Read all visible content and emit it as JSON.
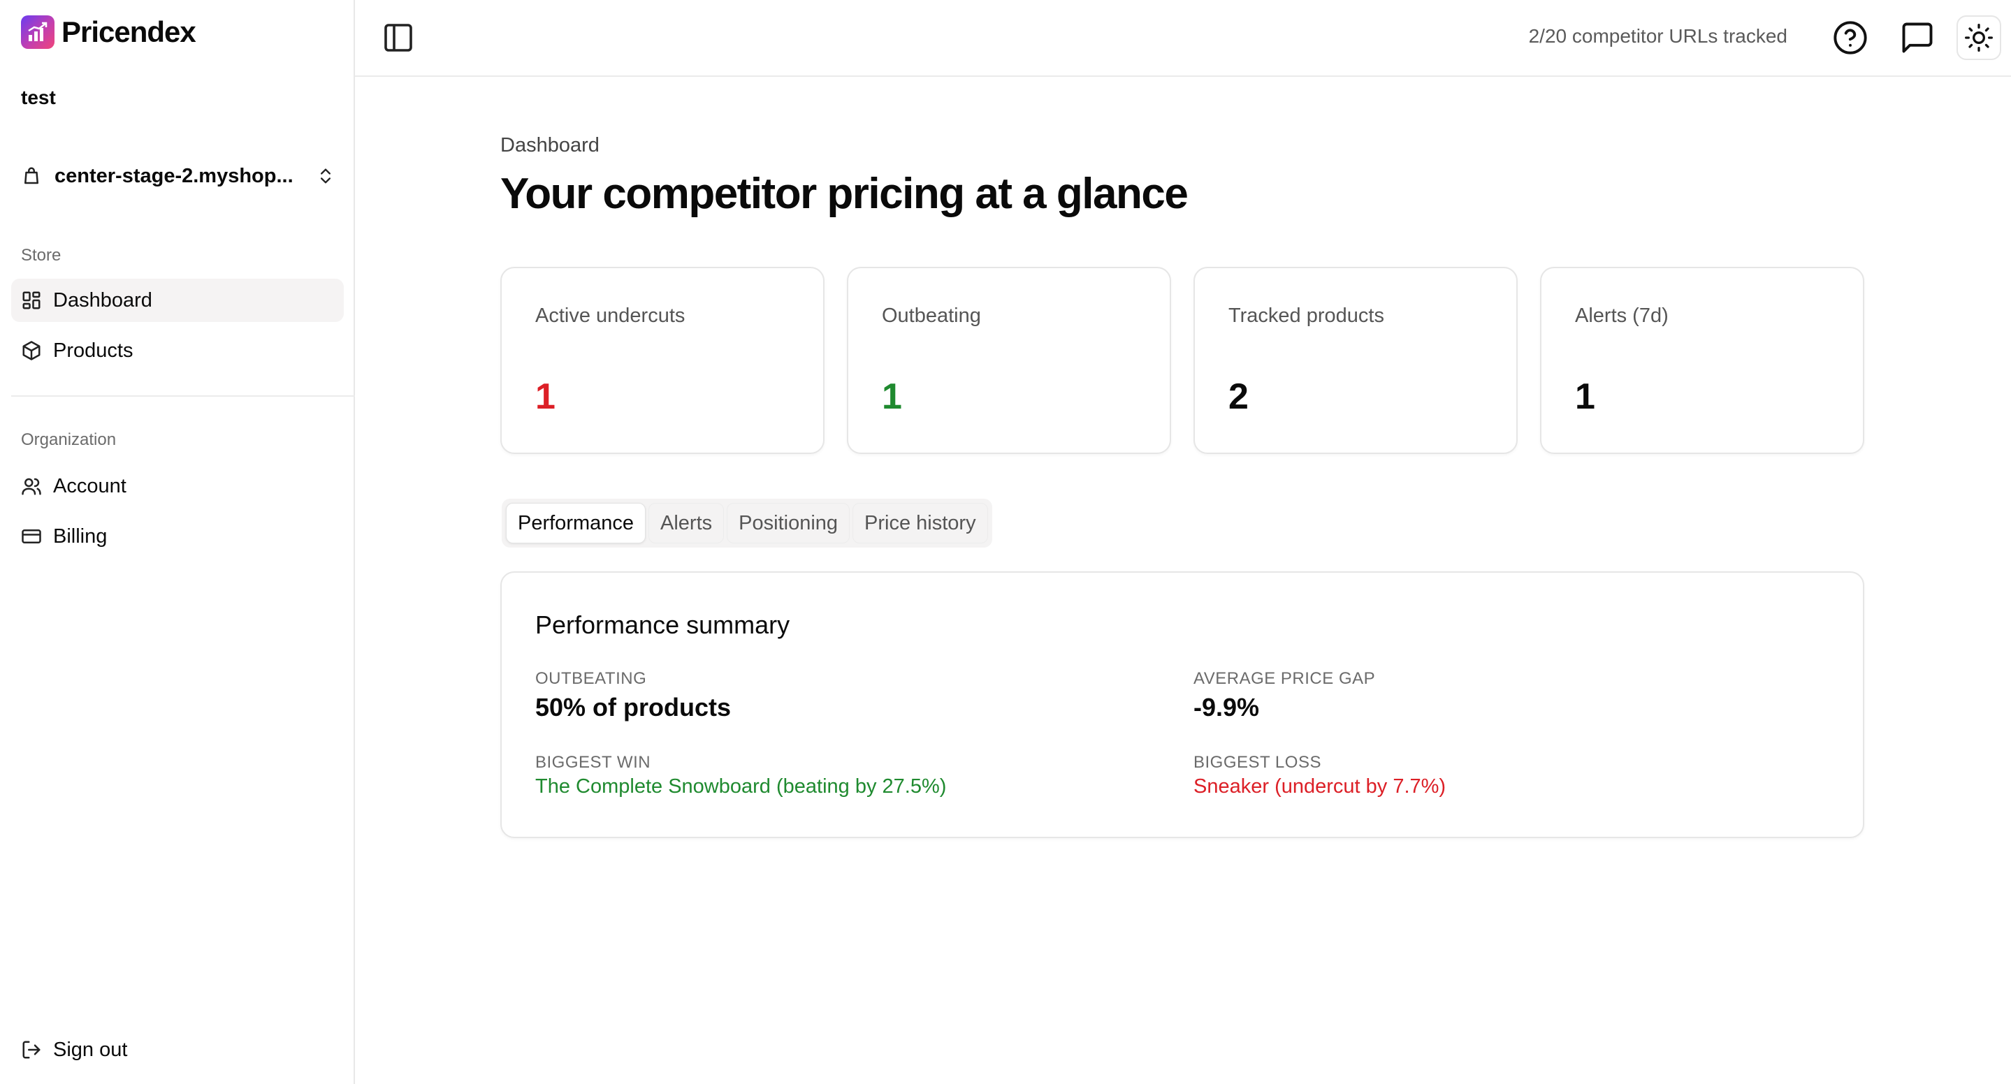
{
  "brand": {
    "name": "Pricendex"
  },
  "sidebar": {
    "org_name": "test",
    "store_selector": "center-stage-2.myshop...",
    "store_section": "Store",
    "store_items": [
      {
        "label": "Dashboard",
        "icon": "dashboard-icon",
        "active": true
      },
      {
        "label": "Products",
        "icon": "box-icon",
        "active": false
      }
    ],
    "org_section": "Organization",
    "org_items": [
      {
        "label": "Account",
        "icon": "users-icon"
      },
      {
        "label": "Billing",
        "icon": "credit-card-icon"
      }
    ],
    "sign_out": "Sign out"
  },
  "topbar": {
    "url_count": "2/20 competitor URLs tracked",
    "icons": [
      "sidebar-toggle-icon",
      "help-icon",
      "message-icon",
      "sun-icon"
    ]
  },
  "page": {
    "breadcrumb": "Dashboard",
    "title": "Your competitor pricing at a glance"
  },
  "stats": [
    {
      "label": "Active undercuts",
      "value": "1",
      "color": "#dc1f26"
    },
    {
      "label": "Outbeating",
      "value": "1",
      "color": "#1f8a2f"
    },
    {
      "label": "Tracked products",
      "value": "2",
      "color": "#0a0a0a"
    },
    {
      "label": "Alerts (7d)",
      "value": "1",
      "color": "#0a0a0a"
    }
  ],
  "tabs": [
    "Performance",
    "Alerts",
    "Positioning",
    "Price history"
  ],
  "active_tab": "Performance",
  "summary": {
    "title": "Performance summary",
    "outbeating_label": "OUTBEATING",
    "outbeating_value": "50% of products",
    "avg_gap_label": "AVERAGE PRICE GAP",
    "avg_gap_value": "-9.9%",
    "biggest_win_label": "BIGGEST WIN",
    "biggest_win_value": "The Complete Snowboard (beating by 27.5%)",
    "biggest_loss_label": "BIGGEST LOSS",
    "biggest_loss_value": "Sneaker (undercut by 7.7%)"
  },
  "colors": {
    "accent_red": "#dc1f26",
    "accent_green": "#1f8a2f",
    "border": "#e6e6e6"
  }
}
